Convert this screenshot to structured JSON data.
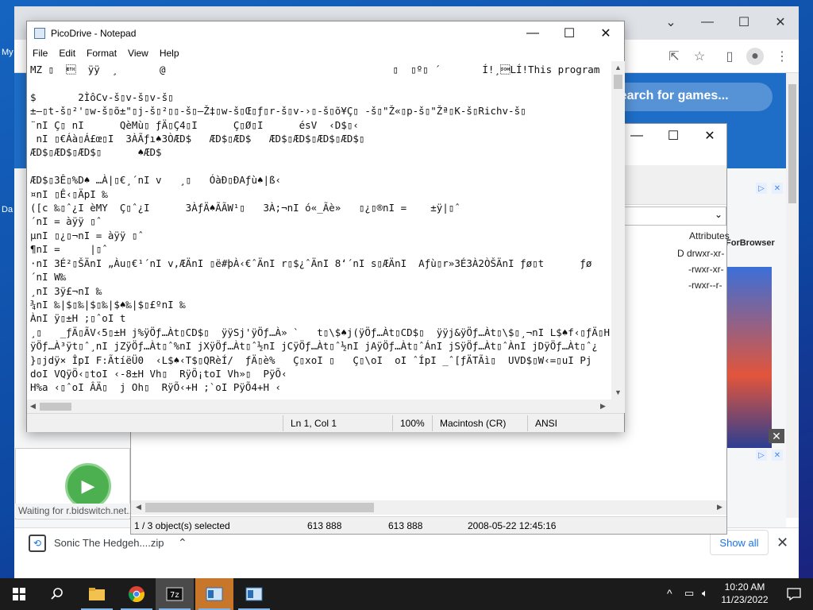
{
  "desktop": {
    "label_1": "My",
    "label_2": "Da"
  },
  "browser": {
    "search_placeholder": "Search for games...",
    "waiting_status": "Waiting for r.bidswitch.net...",
    "ad_badge": "▷✕",
    "ad_title": "ForBrowser",
    "ad_close": "✕"
  },
  "download_bar": {
    "file_name": "Sonic The Hedgeh....zip",
    "show_all": "Show all"
  },
  "file_manager": {
    "column_attributes": "Attributes",
    "rows": [
      "D drwxr-xr-",
      "-rwxr-xr-",
      "-rwxr--r-"
    ],
    "status_selected": "1 / 3 object(s) selected",
    "status_size": "613 888",
    "status_packed": "613 888",
    "status_date": "2008-05-22 12:45:16"
  },
  "notepad": {
    "title": "PicoDrive - Notepad",
    "menu": [
      "File",
      "Edit",
      "Format",
      "View",
      "Help"
    ],
    "lines": [
      "MZ \u0000  \u0003  ÿÿ  ¸       @                                      \u0000  \u0000º\u0000 ´       Í!¸\u0001LÍ!This program",
      "",
      "$       2ÌôCv-š\u0000v-š\u0000v-š\u0000",
      "±—\u0000t-š\u0000²'\u0000w-š\u0000õ±\"\u0000j-š\u0000²\u0000\u0000-š\u0000—Ž‡\u0000w-š\u0000Œ\u0000ƒ\u0000r-š\u0000v-›\u0000-š\u0000õ¥Ç\u0000 -š\u0000\"Ž«\u0000p-š\u0000\"Žª\u0000K-š\u0000Richv-š\u0000",
      "¨nI Ç\u0000 nI      QèMù\u0000 ƒÄ\u0000Ç4\u0000I      Ç\u0000Ø\u0000I      ésV  ‹D$\u0000‹",
      " nI \u0000€Áà\u0000Á£œ\u0000I  3ÀÃƒı♠3ÒÆD$   ÆD$\u0000ÆD$   ÆD$\u0000ÆD$\u0000ÆD$\u0000ÆD$\u0000",
      "ÆD$\u0000ÆD$\u0000ÆD$\u0000      ♠ÆD$",
      "",
      "ÆD$\u00003Ê\u0000%D♠ …À|\u0000€¸´nI v   ¸\u0000   ÓàÐ\u0000ÐAƒù♠|ß‹",
      "¤nI \u0000Ê‹\u0000ÄpI ‰",
      "([c ‰\u0000ˆ¿I èMY  Ç\u0000ˆ¿I      3ÀƒÄ♠ÃÃW¹\u0000   3À;¬nI ó«_Ãè»   \u0000¿\u0000®nI =    ±ÿ|\u0000ˆ",
      "´nI = àÿÿ \u0000ˆ",
      "µnI \u0000¿\u0000¬nI = àÿÿ \u0000ˆ",
      "¶nI =     |\u0000ˆ",
      "·nI 3É²\u0000ŠÄnI „Àu\u0000€¹´nI v,ÆÄnI \u0000ë#þÀ‹€ˆÄnI r\u0000$¿ˆÄnI 8‘´nI s\u0000ÆÄnI  Aƒù\u0000r»3É3À2ÒŠÄnI ƒø\u0000t      ƒø",
      "´nI W‰",
      "¸nI 3ÿ£¬nI ‰",
      "¾nI ‰|$\u0000‰|$\u0000‰|$♠‰|$\u0000£ºnI ‰",
      "ÀnI ÿ\u0000±H ;\u0000ˆoI t",
      "¸\u0000   _ƒÄ\u0000ÃV‹5\u0000±H j%ÿÖƒ…Àt\u0000CD$\u0000  ÿÿSj'ÿÖƒ…À» `   t\u0000\\$♠j(ÿÖƒ…Àt\u0000CD$\u0000  ÿÿj&ÿÖƒ…Àt\u0000\\$\u0000¸¬nI L$♠f‹\u0000ƒÄ\u0000H",
      "ÿÖƒ…À³ÿt\u0000ˆ¸nI jZÿÖƒ…Àt\u0000ˆ%nI jXÿÖƒ…Àt\u0000ˆ½nI jCÿÖƒ…Àt\u0000ˆ½nI jAÿÖƒ…Àt\u0000ˆÁnI jSÿÖƒ…Àt\u0000ˆÀnI jDÿÖƒ…Àt\u0000ˆ¿",
      "}\u0000jdÿ× ÎpI F:ÃtíëÜ0  ‹L$♠‹T$\u0000QRèÍ/  ƒÄ\u0000è%   Ç\u0000xoI \u0000   Ç\u0000\\oI  oI ˆÍpI _ˆ[ƒÄTÃì\u0000  UVD$\u0000W‹=\u0000uI Pj",
      "doI VQÿÖ‹\u0000toI ‹-8±H Vh\u0000  RÿÕ¡toI Vh»\u0000  PÿÕ‹",
      "H%a ‹\u0000ˆoI ÂÄ\u0000  j Oh\u0000  RÿÕ‹+H ;`oI PÿÕ4+H ‹"
    ],
    "status_position": "Ln 1, Col 1",
    "status_zoom": "100%",
    "status_eol": "Macintosh (CR)",
    "status_encoding": "ANSI"
  },
  "taskbar": {
    "clock_time": "10:20 AM",
    "clock_date": "11/23/2022"
  }
}
